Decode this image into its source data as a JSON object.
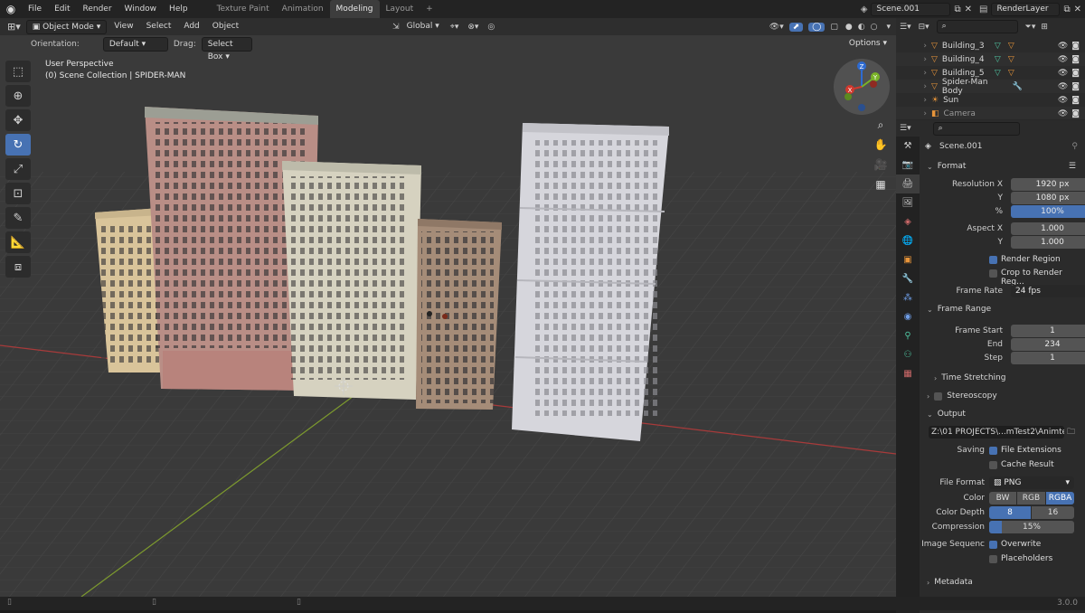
{
  "topbar": {
    "logo_icon": "blender-logo-icon",
    "menus": [
      "File",
      "Edit",
      "Render",
      "Window",
      "Help"
    ],
    "workspaces": [
      "Texture Paint",
      "Animation",
      "Modeling",
      "Layout"
    ],
    "active_workspace": "Modeling",
    "add_workspace": "+",
    "scene_name": "Scene.001",
    "view_layer": "RenderLayer"
  },
  "viewport": {
    "mode": "Object Mode",
    "menus": [
      "View",
      "Select",
      "Add",
      "Object"
    ],
    "transform_orientation": "Global",
    "orientation_label": "Orientation:",
    "orientation_value": "Default",
    "drag_label": "Drag:",
    "drag_value": "Select Box",
    "options": "Options",
    "perspective": "User Perspective",
    "collection": "(0) Scene Collection | SPIDER-MAN",
    "gizmo_axes": [
      "Z",
      "Y",
      "X"
    ],
    "background": "#3a3a3a",
    "grid_color": "#454545",
    "x_axis_color": "#a83a3a",
    "y_axis_color": "#7d9a2e"
  },
  "outliner": {
    "items": [
      {
        "name": "Building_3",
        "icon": "object-mesh-icon"
      },
      {
        "name": "Building_4",
        "icon": "object-mesh-icon"
      },
      {
        "name": "Building_5",
        "icon": "object-mesh-icon"
      },
      {
        "name": "Spider-Man Body",
        "icon": "object-mesh-icon"
      },
      {
        "name": "Sun",
        "icon": "light-icon"
      },
      {
        "name": "Camera",
        "icon": "camera-icon"
      }
    ]
  },
  "properties": {
    "scene_name": "Scene.001",
    "format_title": "Format",
    "resolution_x_label": "Resolution X",
    "resolution_x": "1920 px",
    "resolution_y_label": "Y",
    "resolution_y": "1080 px",
    "percent_label": "%",
    "percent": "100%",
    "aspect_x_label": "Aspect X",
    "aspect_x": "1.000",
    "aspect_y_label": "Y",
    "aspect_y": "1.000",
    "render_region": "Render Region",
    "crop_region": "Crop to Render Reg...",
    "frame_rate_label": "Frame Rate",
    "frame_rate": "24 fps",
    "frame_range_title": "Frame Range",
    "frame_start_label": "Frame Start",
    "frame_start": "1",
    "end_label": "End",
    "end": "234",
    "step_label": "Step",
    "step": "1",
    "time_stretching": "Time Stretching",
    "stereoscopy": "Stereoscopy",
    "output_title": "Output",
    "output_path": "Z:\\01 PROJECTS\\...mTest2\\Animtest2",
    "saving_label": "Saving",
    "file_extensions": "File Extensions",
    "cache_result": "Cache Result",
    "file_format_label": "File Format",
    "file_format": "PNG",
    "color_label": "Color",
    "color_options": [
      "BW",
      "RGB",
      "RGBA"
    ],
    "color_depth_label": "Color Depth",
    "color_depth_options": [
      "8",
      "16"
    ],
    "compression_label": "Compression",
    "compression": "15%",
    "image_seq_label": "Image Sequenc",
    "overwrite": "Overwrite",
    "placeholders": "Placeholders",
    "metadata": "Metadata"
  },
  "status": {
    "version": "3.0.0"
  }
}
